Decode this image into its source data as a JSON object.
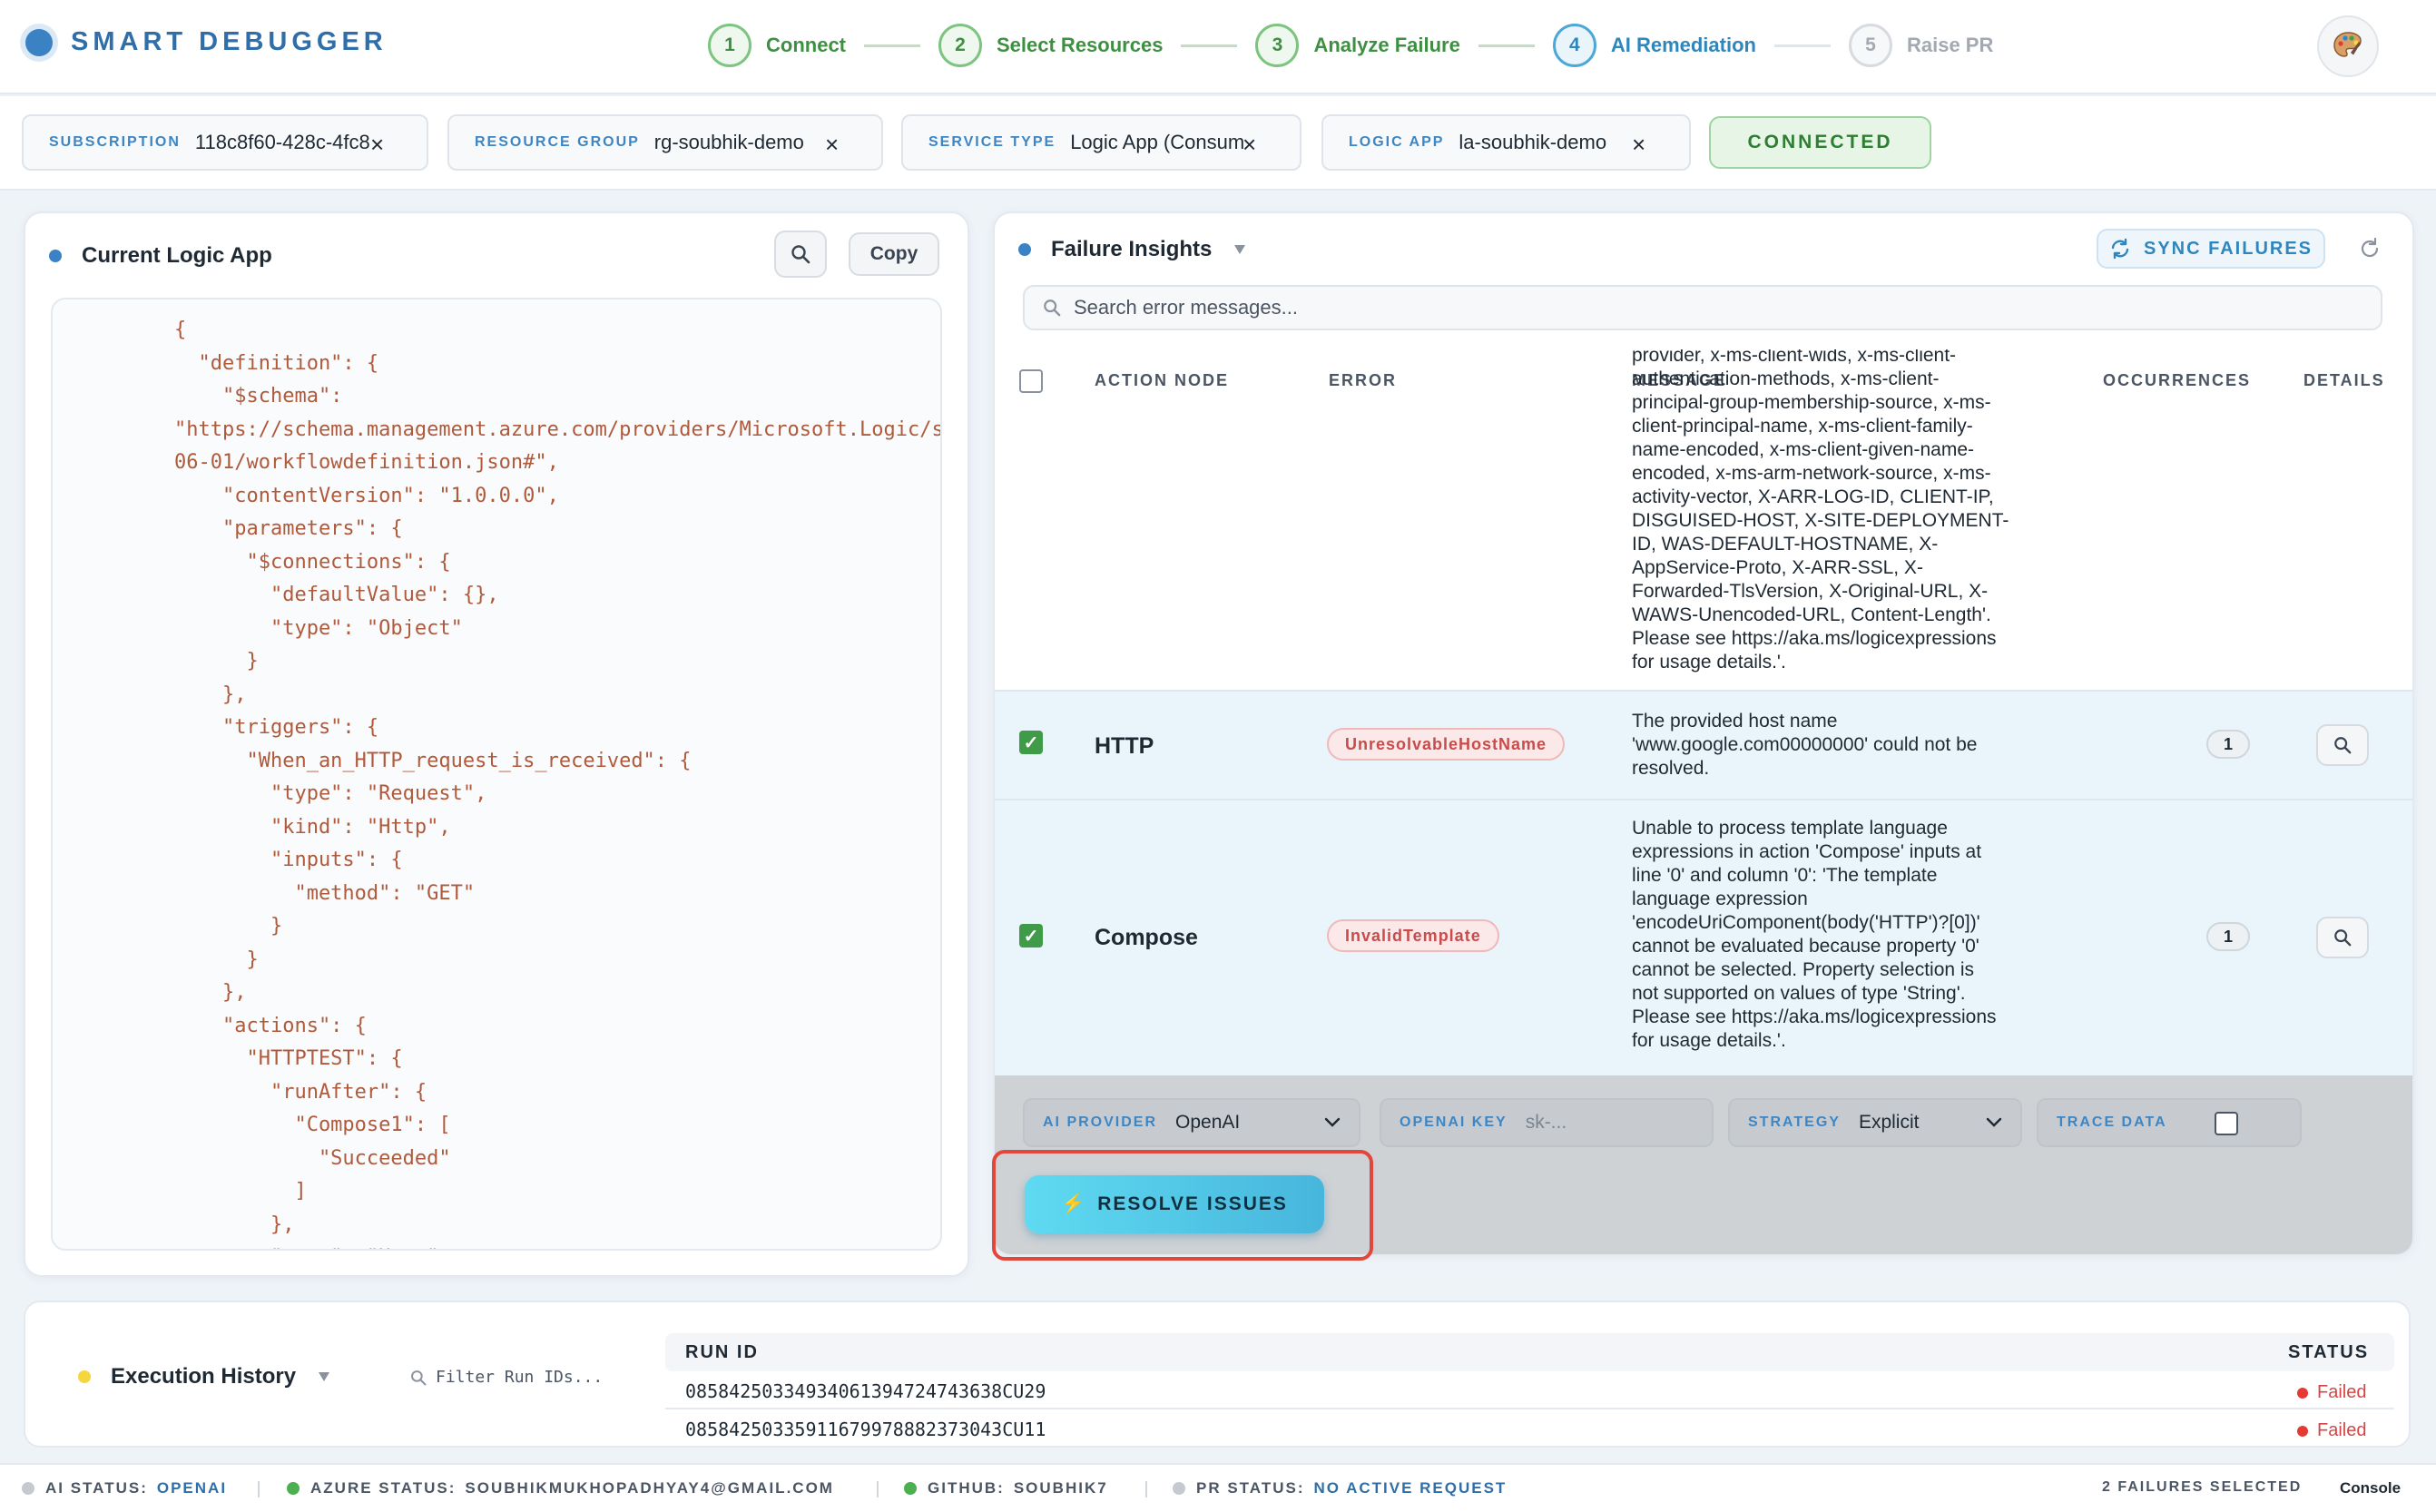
{
  "app": {
    "title": "SMART DEBUGGER"
  },
  "steps": [
    {
      "num": "1",
      "label": "Connect",
      "state": "done"
    },
    {
      "num": "2",
      "label": "Select Resources",
      "state": "done"
    },
    {
      "num": "3",
      "label": "Analyze Failure",
      "state": "done"
    },
    {
      "num": "4",
      "label": "AI Remediation",
      "state": "active"
    },
    {
      "num": "5",
      "label": "Raise PR",
      "state": "pending"
    }
  ],
  "connection": {
    "subscription": {
      "label": "SUBSCRIPTION",
      "value": "118c8f60-428c-4fc8"
    },
    "resource_group": {
      "label": "RESOURCE GROUP",
      "value": "rg-soubhik-demo"
    },
    "service_type": {
      "label": "SERVICE TYPE",
      "value": "Logic App (Consum"
    },
    "logic_app": {
      "label": "LOGIC APP",
      "value": "la-soubhik-demo"
    },
    "status_label": "CONNECTED",
    "clear_glyph": "×"
  },
  "current_app": {
    "title": "Current Logic App",
    "copy_label": "Copy",
    "code": "{\n  \"definition\": {\n    \"$schema\":\n\"https://schema.management.azure.com/providers/Microsoft.Logic/s\n06-01/workflowdefinition.json#\",\n    \"contentVersion\": \"1.0.0.0\",\n    \"parameters\": {\n      \"$connections\": {\n        \"defaultValue\": {},\n        \"type\": \"Object\"\n      }\n    },\n    \"triggers\": {\n      \"When_an_HTTP_request_is_received\": {\n        \"type\": \"Request\",\n        \"kind\": \"Http\",\n        \"inputs\": {\n          \"method\": \"GET\"\n        }\n      }\n    },\n    \"actions\": {\n      \"HTTPTEST\": {\n        \"runAfter\": {\n          \"Compose1\": [\n            \"Succeeded\"\n          ]\n        },\n        \"type\": \"Http\""
  },
  "failures": {
    "title": "Failure Insights",
    "sync_label": "SYNC FAILURES",
    "search_placeholder": "Search error messages...",
    "columns": {
      "action": "ACTION NODE",
      "error": "ERROR",
      "message": "MESSAGE",
      "occurrences": "OCCURRENCES",
      "details": "DETAILS"
    },
    "scrolled_message": "provider, x-ms-client-wids, x-ms-client-\nauthentication-methods, x-ms-client-\nprincipal-group-membership-source, x-ms-\nclient-principal-name, x-ms-client-family-\nname-encoded, x-ms-client-given-name-\nencoded, x-ms-arm-network-source, x-ms-\nactivity-vector, X-ARR-LOG-ID, CLIENT-IP,\nDISGUISED-HOST, X-SITE-DEPLOYMENT-\nID, WAS-DEFAULT-HOSTNAME, X-\nAppService-Proto, X-ARR-SSL, X-\nForwarded-TlsVersion, X-Original-URL, X-\nWAWS-Unencoded-URL, Content-Length'.\nPlease see https://aka.ms/logicexpressions\nfor usage details.'.",
    "rows": [
      {
        "action": "HTTP",
        "error": "UnresolvableHostName",
        "message": "The provided host name\n'www.google.com00000000' could not be\nresolved.",
        "occurrences": "1"
      },
      {
        "action": "Compose",
        "error": "InvalidTemplate",
        "message": "Unable to process template language\nexpressions in action 'Compose' inputs at\nline '0' and column '0': 'The template\nlanguage expression\n'encodeUriComponent(body('HTTP')?[0])'\ncannot be evaluated because property '0'\ncannot be selected. Property selection is\nnot supported on values of type 'String'.\nPlease see https://aka.ms/logicexpressions\nfor usage details.'.",
        "occurrences": "1"
      }
    ]
  },
  "remediation": {
    "provider": {
      "label": "AI PROVIDER",
      "value": "OpenAI"
    },
    "key": {
      "label": "OPENAI KEY",
      "placeholder": "sk-..."
    },
    "strategy": {
      "label": "STRATEGY",
      "value": "Explicit"
    },
    "trace": {
      "label": "TRACE DATA"
    },
    "resolve_label": "RESOLVE ISSUES",
    "resolve_glyph": "⚡"
  },
  "history": {
    "title": "Execution History",
    "filter_placeholder": "Filter Run IDs...",
    "columns": {
      "run_id": "RUN ID",
      "status": "STATUS"
    },
    "runs": [
      {
        "run_id": "08584250334934061394724743638CU29",
        "status": "Failed"
      },
      {
        "run_id": "08584250335911679978882373043CU11",
        "status": "Failed"
      }
    ]
  },
  "statusbar": {
    "ai": {
      "label": "AI STATUS:",
      "value": "OPENAI"
    },
    "azure": {
      "label": "AZURE STATUS:",
      "value": "SOUBHIKMUKHOPADHYAY4@GMAIL.COM"
    },
    "github": {
      "label": "GITHUB:",
      "value": "SOUBHIK7"
    },
    "pr": {
      "label": "PR STATUS:",
      "value": "NO ACTIVE REQUEST"
    },
    "selected": "2 FAILURES SELECTED",
    "console": "Console"
  },
  "colors": {
    "accent": "#3b82c4",
    "success": "#3f8f43",
    "danger": "#c94b4b",
    "warning": "#f5d63d"
  }
}
